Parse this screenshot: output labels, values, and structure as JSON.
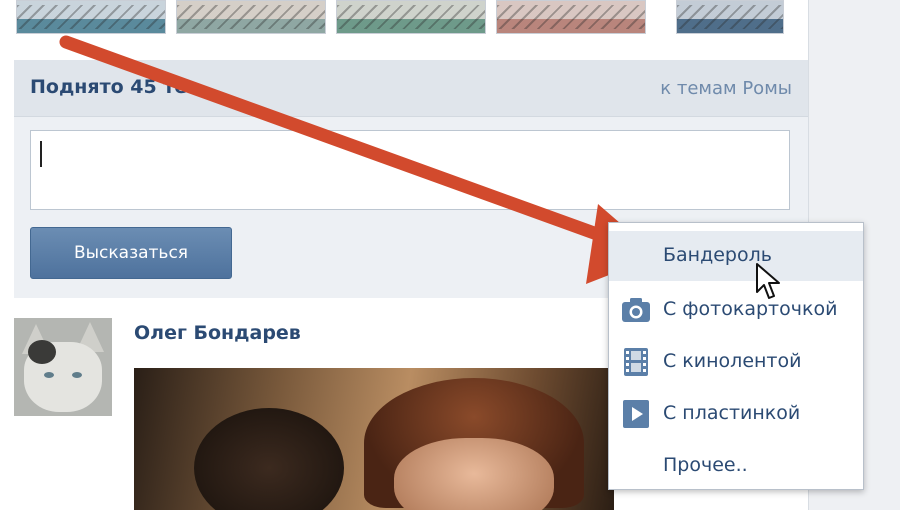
{
  "colors": {
    "link_blue": "#2b4a73",
    "muted_link": "#6f8aab",
    "button_blue": "#5b7fa8",
    "arrow_red": "#d24a2d",
    "panel_bg": "#edf0f4"
  },
  "thumbnails": [
    {
      "name": "photo-1"
    },
    {
      "name": "photo-2"
    },
    {
      "name": "photo-3"
    },
    {
      "name": "photo-4"
    },
    {
      "name": "photo-5"
    }
  ],
  "discussion": {
    "title": "Поднято 45 те",
    "back_link": "к темам Ромы",
    "comment_value": "",
    "submit_label": "Высказаться"
  },
  "post": {
    "author": "Олег Бондарев"
  },
  "attach_menu": {
    "items": [
      {
        "label": "Бандероль",
        "icon": "none"
      },
      {
        "label": "С фотокарточкой",
        "icon": "camera-icon"
      },
      {
        "label": "С кинолентой",
        "icon": "film-icon"
      },
      {
        "label": "С пластинкой",
        "icon": "play-icon"
      },
      {
        "label": "Прочее..",
        "icon": "none"
      }
    ]
  }
}
